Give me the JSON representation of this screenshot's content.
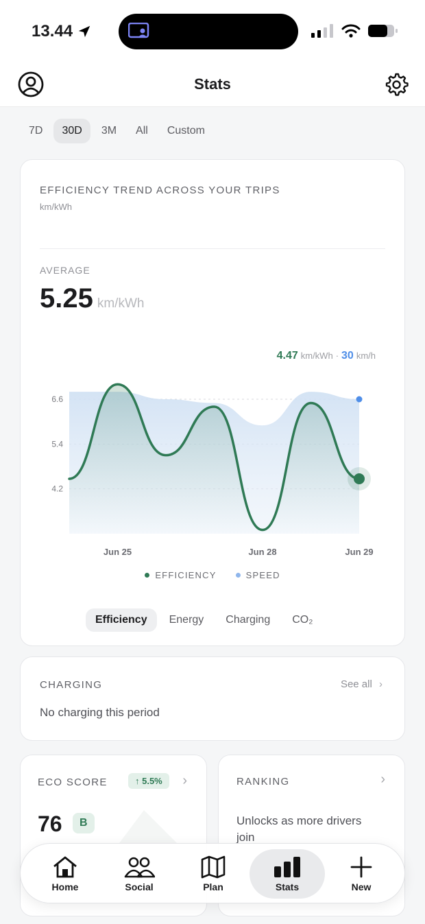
{
  "status_bar": {
    "time": "13.44"
  },
  "header": {
    "title": "Stats"
  },
  "period_tabs": [
    {
      "label": "7D",
      "active": false
    },
    {
      "label": "30D",
      "active": true
    },
    {
      "label": "3M",
      "active": false
    },
    {
      "label": "All",
      "active": false
    },
    {
      "label": "Custom",
      "active": false
    }
  ],
  "efficiency_card": {
    "title": "EFFICIENCY TREND ACROSS YOUR TRIPS",
    "unit": "km/kWh",
    "average_label": "AVERAGE",
    "average_value": "5.25",
    "average_unit": "km/kWh",
    "readout": {
      "efficiency": "4.47",
      "efficiency_unit": "km/kWh",
      "separator": "·",
      "speed": "30",
      "speed_unit": "km/h"
    },
    "legend": {
      "efficiency": "EFFICIENCY",
      "speed": "SPEED"
    },
    "metric_tabs": [
      {
        "label": "Efficiency",
        "active": true
      },
      {
        "label": "Energy",
        "active": false
      },
      {
        "label": "Charging",
        "active": false
      },
      {
        "label": "CO₂",
        "active": false
      }
    ]
  },
  "colors": {
    "efficiency": "#2f7a55",
    "speed": "#4f8ee8",
    "speed_area": "#dce8f5"
  },
  "chart_data": {
    "type": "line",
    "y_ticks": [
      "6.6",
      "5.4",
      "4.2"
    ],
    "ylim": [
      3.0,
      7.5
    ],
    "x_tick_labels": [
      "Jun 25",
      "Jun 28",
      "Jun 29"
    ],
    "x": [
      "Jun 24",
      "Jun 25",
      "Jun 26",
      "Jun 27",
      "Jun 28",
      "Jun 28",
      "Jun 29"
    ],
    "series": [
      {
        "name": "EFFICIENCY",
        "values": [
          4.47,
          7.0,
          5.1,
          6.4,
          3.1,
          6.5,
          4.47
        ]
      },
      {
        "name": "SPEED",
        "values": [
          6.8,
          6.8,
          6.6,
          6.5,
          5.9,
          6.8,
          6.6
        ]
      }
    ]
  },
  "charging_card": {
    "title": "CHARGING",
    "see_all": "See all",
    "empty": "No charging this period"
  },
  "eco_card": {
    "title": "ECO SCORE",
    "change": "↑ 5.5%",
    "score": "76",
    "grade": "B"
  },
  "ranking_card": {
    "title": "RANKING",
    "text": "Unlocks as more drivers join"
  },
  "nav": [
    {
      "label": "Home",
      "icon": "home-icon",
      "active": false
    },
    {
      "label": "Social",
      "icon": "people-icon",
      "active": false
    },
    {
      "label": "Plan",
      "icon": "map-icon",
      "active": false
    },
    {
      "label": "Stats",
      "icon": "bar-chart-icon",
      "active": true
    },
    {
      "label": "New",
      "icon": "plus-icon",
      "active": false
    }
  ]
}
